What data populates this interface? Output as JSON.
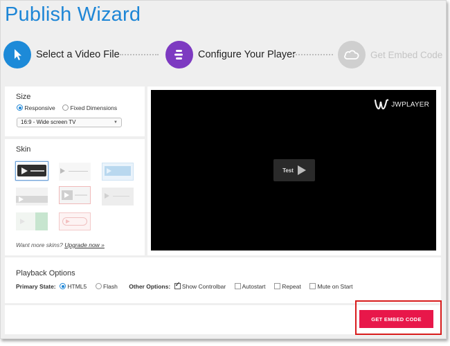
{
  "header": {
    "title": "Publish Wizard"
  },
  "steps": [
    {
      "label": "Select a Video File",
      "icon": "cursor-icon",
      "color": "#1d8ad8",
      "state": "completed"
    },
    {
      "label": "Configure Your Player",
      "icon": "sliders-icon",
      "color": "#7d3ac1",
      "state": "active"
    },
    {
      "label": "Get Embed Code",
      "icon": "cloud-icon",
      "color": "#cfcfcf",
      "state": "upcoming"
    }
  ],
  "size": {
    "heading": "Size",
    "options": [
      {
        "label": "Responsive",
        "selected": true
      },
      {
        "label": "Fixed Dimensions",
        "selected": false
      }
    ],
    "aspect_ratio": "16:9 - Wide screen TV"
  },
  "skin": {
    "heading": "Skin",
    "selected_index": 0,
    "upsell_text": "Want more skins?",
    "upgrade_link": "Upgrade now »"
  },
  "player": {
    "brand": "JWPLAYER",
    "test_label": "Test"
  },
  "playback": {
    "heading": "Playback Options",
    "primary_state_label": "Primary State:",
    "primary_states": [
      {
        "label": "HTML5",
        "selected": true
      },
      {
        "label": "Flash",
        "selected": false
      }
    ],
    "other_options_label": "Other Options:",
    "other_options": [
      {
        "label": "Show Controlbar",
        "checked": true
      },
      {
        "label": "Autostart",
        "checked": false
      },
      {
        "label": "Repeat",
        "checked": false
      },
      {
        "label": "Mute on Start",
        "checked": false
      }
    ]
  },
  "footer": {
    "embed_button": "GET EMBED CODE"
  },
  "colors": {
    "accent": "#1e86d6",
    "cta": "#e8174a",
    "highlight": "#d81b1b"
  }
}
